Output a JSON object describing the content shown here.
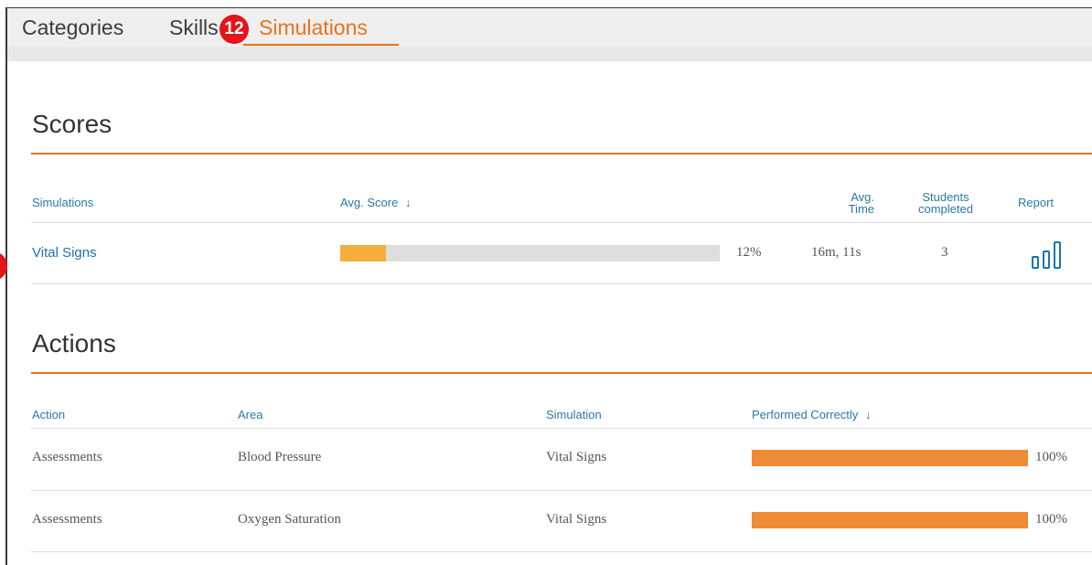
{
  "tabs": [
    {
      "label": "Categories"
    },
    {
      "label": "Skills"
    },
    {
      "label": "Simulations",
      "active": true
    }
  ],
  "badges": {
    "tab_marker": "12"
  },
  "scores": {
    "title": "Scores",
    "headers": {
      "simulations": "Simulations",
      "avg_score": "Avg. Score",
      "sort_arrow": "↓",
      "avg_time_line1": "Avg.",
      "avg_time_line2": "Time",
      "students_line1": "Students",
      "students_line2": "completed",
      "report": "Report"
    },
    "rows": [
      {
        "simulation": "Vital Signs",
        "score_pct": 12,
        "score_text": "12%",
        "avg_time": "16m, 11s",
        "students": "3"
      }
    ]
  },
  "actions": {
    "title": "Actions",
    "headers": {
      "action": "Action",
      "area": "Area",
      "simulation": "Simulation",
      "performed": "Performed Correctly",
      "sort_arrow": "↓"
    },
    "rows": [
      {
        "action": "Assessments",
        "area": "Blood Pressure",
        "simulation": "Vital Signs",
        "pct": 100,
        "pct_text": "100%"
      },
      {
        "action": "Assessments",
        "area": "Oxygen Saturation",
        "simulation": "Vital Signs",
        "pct": 100,
        "pct_text": "100%"
      }
    ]
  },
  "colors": {
    "accent": "#e9721b",
    "score_fill": "#f5ad3c",
    "action_fill": "#ef8a36",
    "link": "#1a73b5",
    "header_link": "#2a79a8",
    "track": "#dedede"
  }
}
